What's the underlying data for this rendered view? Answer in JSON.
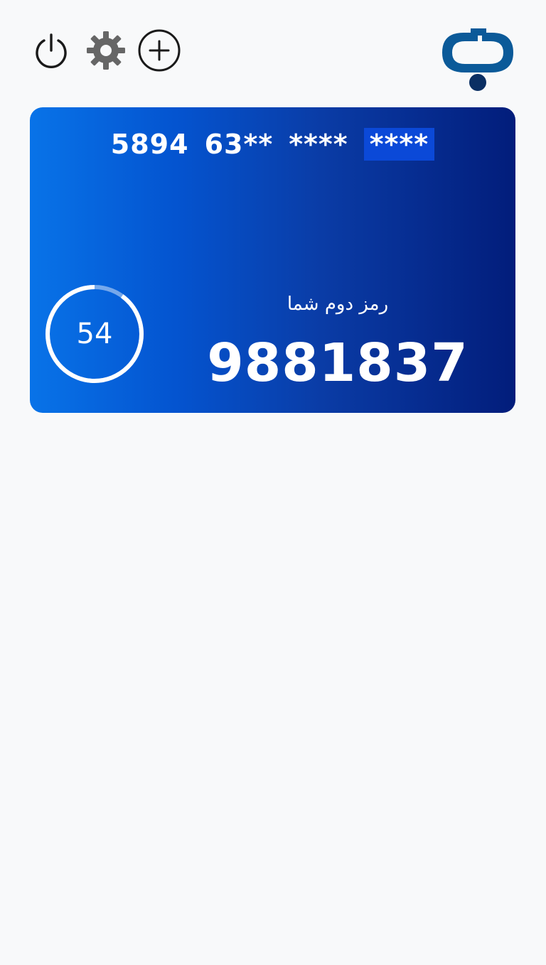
{
  "header": {
    "icons": {
      "power": "power-icon",
      "settings": "gear-icon",
      "add": "plus-circle-icon",
      "logo": "bank-refah-logo-icon"
    }
  },
  "card": {
    "number_groups": [
      "5894",
      "63**",
      "****",
      "****"
    ],
    "otp_label": "رمز دوم شما",
    "otp_code": "9881837",
    "timer_value": "54",
    "timer_progress": 0.9,
    "gradient": [
      "#0873e8",
      "#021d7b"
    ]
  },
  "colors": {
    "background": "#f8f9fa",
    "icon_dark": "#1a1a1a",
    "icon_gray": "#666666",
    "logo_blue": "#0b5a99",
    "logo_navy": "#0a2f63"
  }
}
